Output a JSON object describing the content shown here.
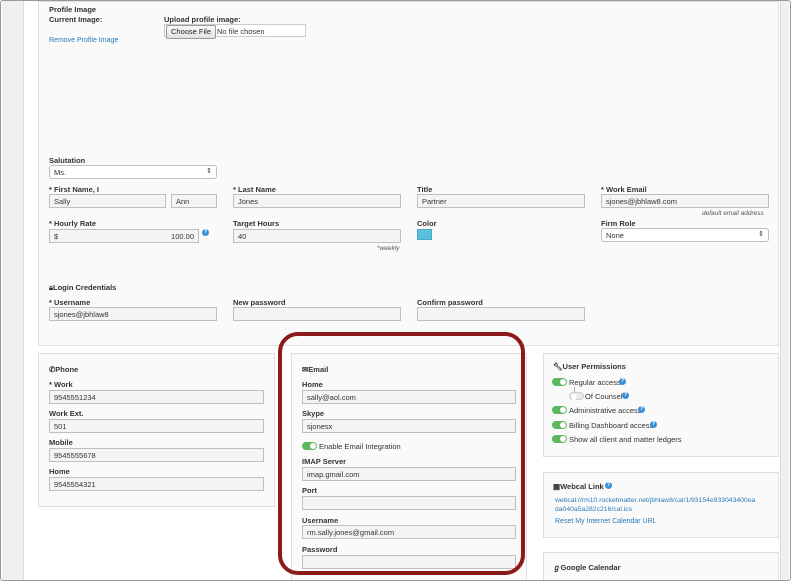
{
  "profile": {
    "section_label": "Profile Image",
    "current_image_label": "Current Image:",
    "remove_link": "Remove Profile Image",
    "upload_label": "Upload profile image:",
    "choose_file_button": "Choose File",
    "no_file_text": "No file chosen"
  },
  "salutation": {
    "label": "Salutation",
    "value": "Ms."
  },
  "first_name": {
    "label": "* First Name, I",
    "value": "Sally",
    "initial": "Ann"
  },
  "last_name": {
    "label": "* Last Name",
    "value": "Jones"
  },
  "title": {
    "label": "Title",
    "value": "Partner"
  },
  "work_email": {
    "label": "* Work Email",
    "value": "sjones@jbhlaw8.com",
    "note": "default email address"
  },
  "hourly_rate": {
    "label": "* Hourly Rate",
    "currency": "$",
    "value": "100.00"
  },
  "target_hours": {
    "label": "Target Hours",
    "value": "40",
    "note": "*weekly"
  },
  "color": {
    "label": "Color",
    "swatch": "#5bc0de"
  },
  "firm_role": {
    "label": "Firm Role",
    "value": "None"
  },
  "login": {
    "title": "Login Credentials",
    "username_label": "* Username",
    "username_value": "sjones@jbhlaw8",
    "new_password_label": "New password",
    "confirm_password_label": "Confirm password"
  },
  "phone": {
    "title": "Phone",
    "fields": [
      {
        "label": "* Work",
        "value": "9545551234"
      },
      {
        "label": "Work Ext.",
        "value": "501"
      },
      {
        "label": "Mobile",
        "value": "9545555678"
      },
      {
        "label": "Home",
        "value": "9545554321"
      }
    ]
  },
  "email": {
    "title": "Email",
    "home_label": "Home",
    "home_value": "sally@aol.com",
    "skype_label": "Skype",
    "skype_value": "sjonesx",
    "integration_label": "Enable Email Integration",
    "imap_label": "IMAP Server",
    "imap_value": "imap.gmail.com",
    "port_label": "Port",
    "port_value": "",
    "username_label": "Username",
    "username_value": "rm.sally.jones@gmail.com",
    "password_label": "Password",
    "password_value": ""
  },
  "permissions": {
    "title": "User Permissions",
    "items": [
      {
        "label": "Regular access",
        "on": true
      },
      {
        "label": "Of Counsel",
        "on": false
      },
      {
        "label": "Administrative access",
        "on": true
      },
      {
        "label": "Billing Dashboard access",
        "on": true
      },
      {
        "label": "Show all client and matter ledgers",
        "on": true
      }
    ]
  },
  "webcal": {
    "title": "Webcal Link",
    "url_line1": "webcal://rm10.rocketmatter.net/jbhlaw8/cal/1/93154e933043400ea",
    "url_line2": "da040a5a282c216/cal.ics",
    "reset_link": "Reset My Internet Calendar URL"
  },
  "google": {
    "title": "Google Calendar"
  },
  "colors": {
    "accent": "#2a7ab8",
    "toggle_on": "#5cb85c",
    "highlight": "#8b1a1a"
  }
}
